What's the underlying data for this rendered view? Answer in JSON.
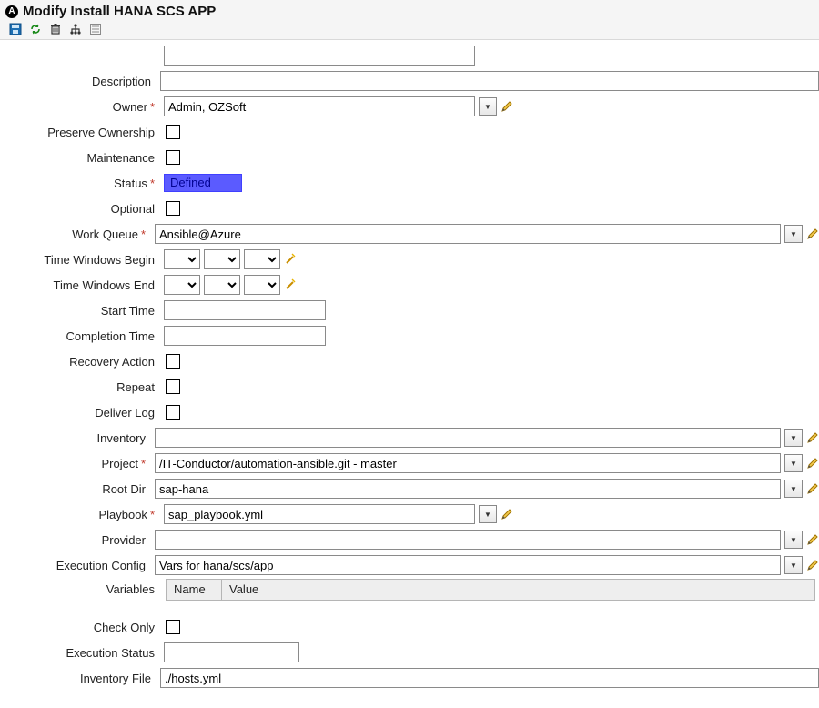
{
  "header": {
    "title": "Modify Install HANA SCS APP"
  },
  "fields": {
    "description_label": "Description",
    "description_value": "",
    "owner_label": "Owner",
    "owner_value": "Admin, OZSoft",
    "preserve_ownership_label": "Preserve Ownership",
    "maintenance_label": "Maintenance",
    "status_label": "Status",
    "status_value": "Defined",
    "optional_label": "Optional",
    "work_queue_label": "Work Queue",
    "work_queue_value": "Ansible@Azure",
    "tw_begin_label": "Time Windows Begin",
    "tw_end_label": "Time Windows End",
    "start_time_label": "Start Time",
    "start_time_value": "",
    "completion_time_label": "Completion Time",
    "completion_time_value": "",
    "recovery_action_label": "Recovery Action",
    "repeat_label": "Repeat",
    "deliver_log_label": "Deliver Log",
    "inventory_label": "Inventory",
    "inventory_value": "",
    "project_label": "Project",
    "project_value": "/IT-Conductor/automation-ansible.git - master",
    "root_dir_label": "Root Dir",
    "root_dir_value": "sap-hana",
    "playbook_label": "Playbook",
    "playbook_value": "sap_playbook.yml",
    "provider_label": "Provider",
    "provider_value": "",
    "exec_config_label": "Execution Config",
    "exec_config_value": "Vars for hana/scs/app",
    "variables_label": "Variables",
    "var_col_name": "Name",
    "var_col_value": "Value",
    "check_only_label": "Check Only",
    "exec_status_label": "Execution Status",
    "exec_status_value": "",
    "inventory_file_label": "Inventory File",
    "inventory_file_value": "./hosts.yml"
  },
  "glyphs": {
    "required": "*",
    "dropdown": "▼"
  }
}
